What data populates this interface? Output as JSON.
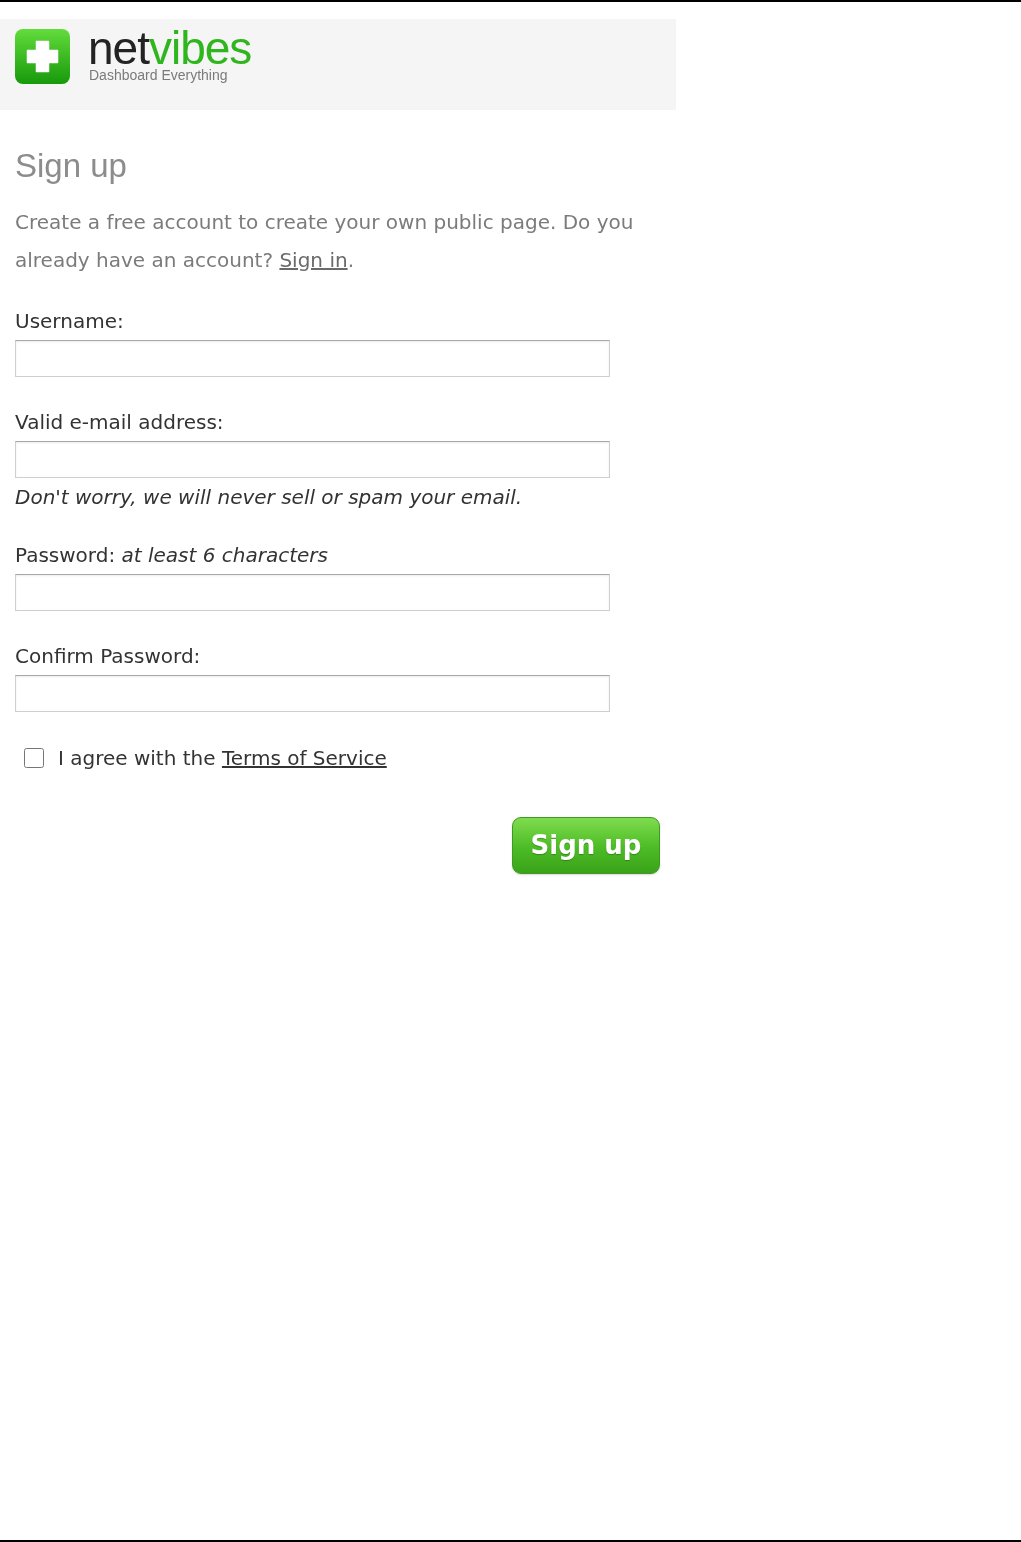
{
  "header": {
    "wordmark_parts": [
      "net",
      "vibes"
    ],
    "tagline": "Dashboard Everything"
  },
  "heading": "Sign up",
  "intro": {
    "text": "Create a free account to create your own public page. Do you already have an account?",
    "link": "Sign in",
    "after": "."
  },
  "fields": [
    {
      "label": "Username:"
    },
    {
      "label": "Valid e-mail address:",
      "note": "Don't worry, we will never sell or spam your email."
    },
    {
      "label": "Password: *at least 6 characters*"
    },
    {
      "label": "Confirm Password:"
    }
  ],
  "agreement": {
    "checked": false,
    "text": "I agree with the",
    "link": "Terms of Service"
  },
  "submit": "Sign up"
}
